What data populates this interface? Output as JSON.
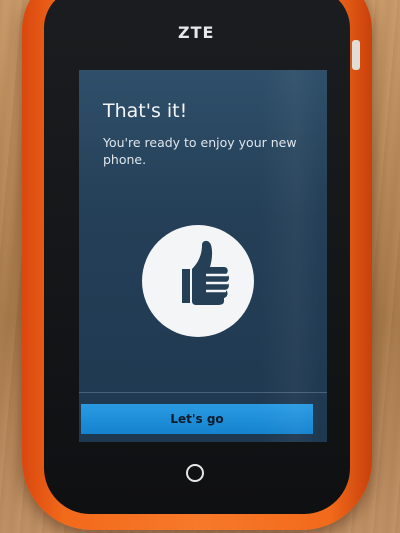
{
  "device": {
    "brand": "ZTE"
  },
  "screen": {
    "title": "That's it!",
    "subtitle": "You're ready to enjoy your new phone.",
    "icon": "thumbs-up-icon",
    "button_label": "Let's go"
  },
  "colors": {
    "phone_shell": "#f26a1b",
    "screen_bg": "#2f4f6a",
    "button_bg": "#2a9be3",
    "icon_circle": "#f3f5f6"
  }
}
